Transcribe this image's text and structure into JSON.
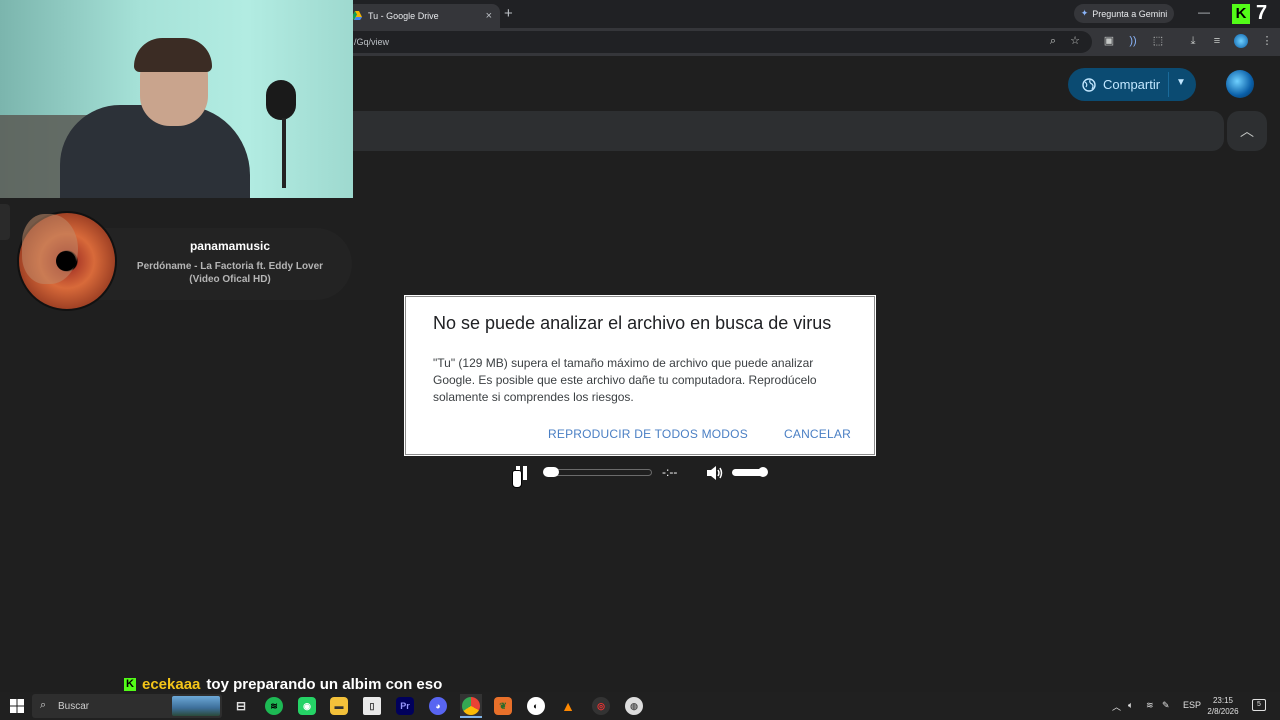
{
  "browser": {
    "tab_title": "Tu - Google Drive",
    "tab_close": "×",
    "new_tab": "+",
    "gemini_label": "Pregunta a Gemini",
    "url_visible": "/Gq/view",
    "minimize": "—"
  },
  "stream": {
    "kick_logo": "K",
    "viewer_count": "7"
  },
  "drive": {
    "share_label": "Compartir"
  },
  "now_playing": {
    "username": "panamamusic",
    "track": "Perdóname - La Factoria ft. Eddy Lover (Video Ofical HD)"
  },
  "dialog": {
    "title": "No se puede analizar el archivo en busca de virus",
    "body": "\"Tu\" (129 MB) supera el tamaño máximo de archivo que puede analizar Google. Es posible que este archivo dañe tu computadora. Reprodúcelo solamente si comprendes los riesgos.",
    "play_anyway": "REPRODUCIR DE TODOS MODOS",
    "cancel": "CANCELAR"
  },
  "player": {
    "time": "-:--",
    "progress": 0.0,
    "volume": 1.0
  },
  "chat": {
    "badge": "K",
    "user": "ecekaaa",
    "message": "toy preparando un albim con eso"
  },
  "taskbar": {
    "search_placeholder": "Buscar",
    "language": "ESP",
    "time": "23:15",
    "date": "2/8/2026",
    "notifications": "5"
  },
  "colors": {
    "share_bg": "#0b4b72",
    "dialog_link": "#4a7fc4",
    "kick_green": "#53fc18",
    "chat_user": "#f5c518"
  }
}
